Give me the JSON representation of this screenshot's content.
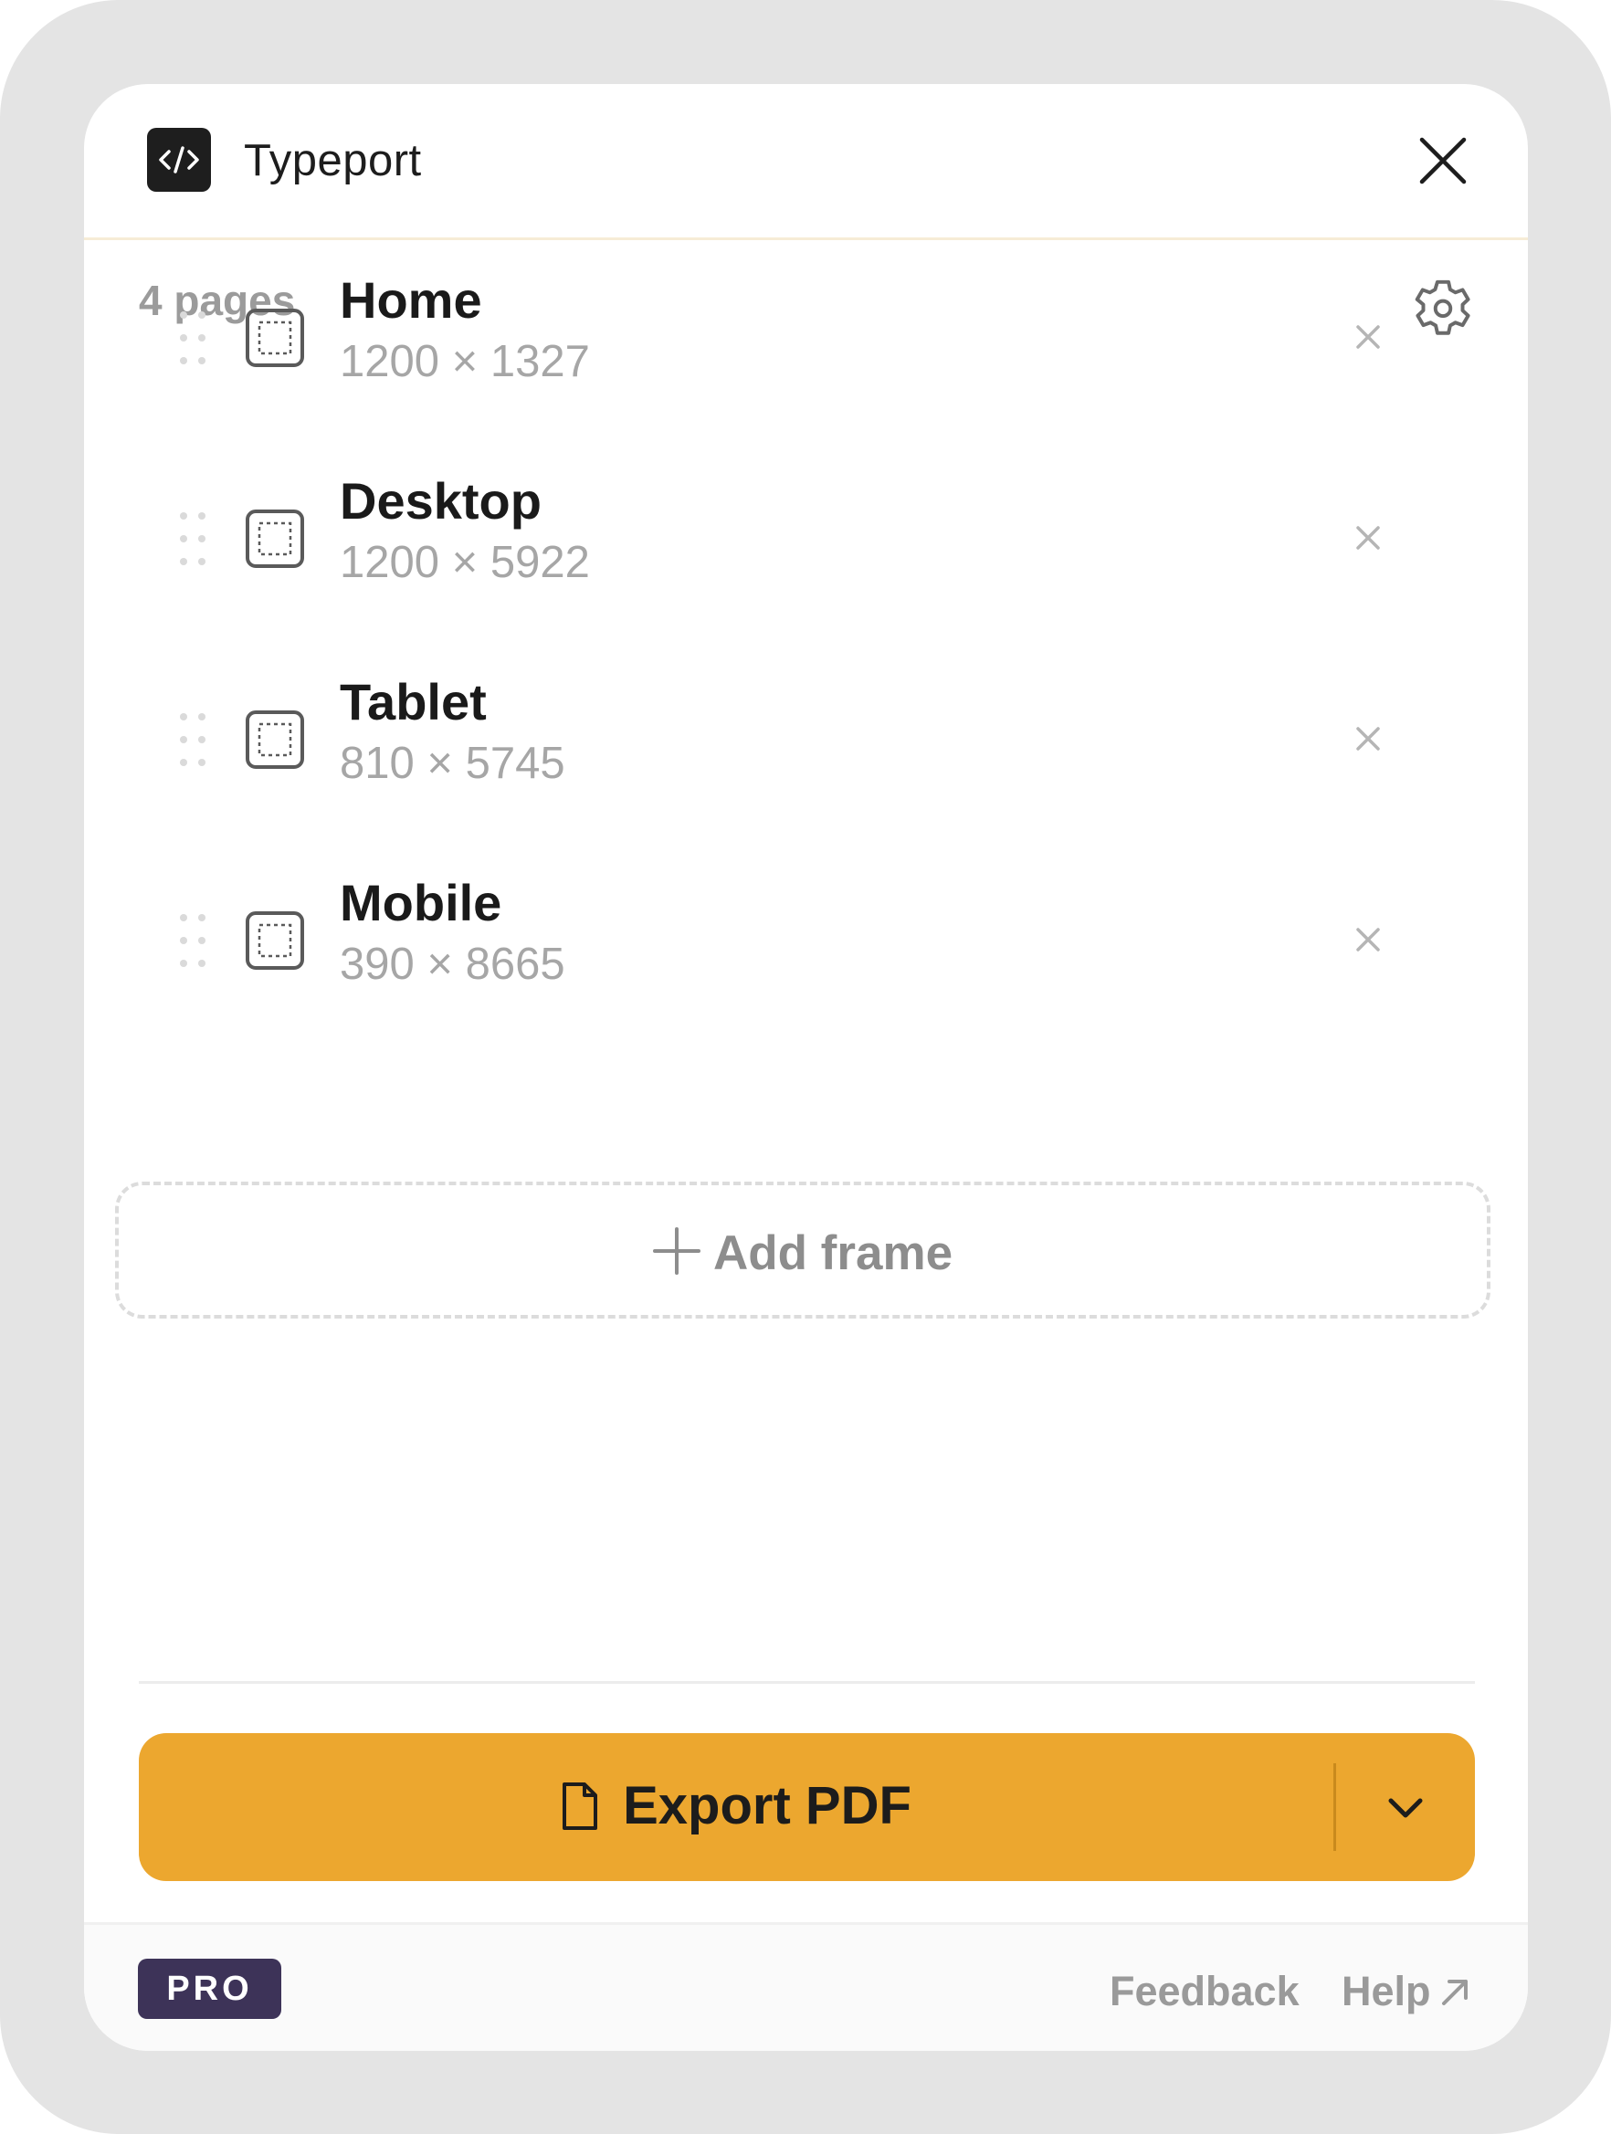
{
  "header": {
    "title": "Typeport",
    "logo_icon": "code-icon",
    "close_icon": "close-icon"
  },
  "frames_panel": {
    "page_count": "4 pages",
    "settings_icon": "gear-icon",
    "items": [
      {
        "name": "Home",
        "size": "1200 × 1327"
      },
      {
        "name": "Desktop",
        "size": "1200 × 5922"
      },
      {
        "name": "Tablet",
        "size": "810 × 5745"
      },
      {
        "name": "Mobile",
        "size": "390 × 8665"
      }
    ],
    "add_frame_label": "Add frame"
  },
  "export": {
    "label": "Export PDF",
    "file_icon": "file-icon",
    "dropdown_icon": "chevron-down-icon"
  },
  "footer": {
    "badge": "PRO",
    "feedback_label": "Feedback",
    "help_label": "Help",
    "help_icon": "arrow-up-right-icon"
  },
  "colors": {
    "accent": "#eca72f",
    "badge_bg": "#3d3358",
    "frame_bg": "#e4e4e4"
  }
}
